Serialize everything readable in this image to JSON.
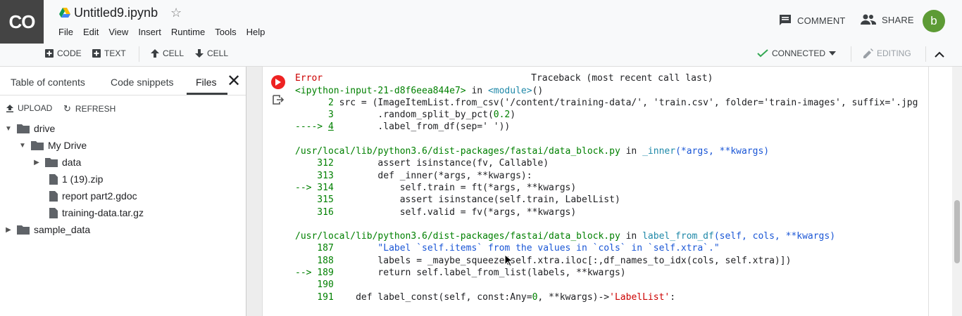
{
  "app": {
    "logo": "CO",
    "title": "Untitled9.ipynb",
    "menu": [
      "File",
      "Edit",
      "View",
      "Insert",
      "Runtime",
      "Tools",
      "Help"
    ],
    "comment_label": "COMMENT",
    "share_label": "SHARE",
    "avatar_letter": "b"
  },
  "toolbar": {
    "code_label": "CODE",
    "text_label": "TEXT",
    "cell_up_label": "CELL",
    "cell_down_label": "CELL",
    "connected_label": "CONNECTED",
    "editing_label": "EDITING"
  },
  "sidebar": {
    "tabs": [
      "Table of contents",
      "Code snippets",
      "Files"
    ],
    "upload_label": "UPLOAD",
    "refresh_label": "REFRESH",
    "tree": [
      {
        "label": "drive"
      },
      {
        "label": "My Drive"
      },
      {
        "label": "data"
      },
      {
        "label": "1 (19).zip"
      },
      {
        "label": "report part2.gdoc"
      },
      {
        "label": "training-data.tar.gz"
      },
      {
        "label": "sample_data"
      }
    ]
  },
  "output": {
    "dash_line": "---------------------------------------------------------------------------",
    "err_name": "Error",
    "traceback": "Traceback (most recent call last)",
    "frame1": {
      "input": "<ipython-input-21-d8f6eea844e7>",
      "in": " in ",
      "module": "<module>",
      "suffix": "()"
    },
    "l2_num": "      2",
    "l2_code": " src = (ImageItemList.from_csv('/content/training-data/', 'train.csv', folder='train-images', suffix='.jpg",
    "l3_num": "      3",
    "l3_code": "        .random_split_by_pct(",
    "l3_val": "0.2",
    "l3_end": ")",
    "l4_arrow": "----> ",
    "l4_num": "4",
    "l4_code": "        .label_from_df(sep=' '))",
    "frame2_path": "/usr/local/lib/python3.6/dist-packages/fastai/data_block.py",
    "frame2_in": " in ",
    "frame2_func": "_inner",
    "frame2_args": "(*args, **kwargs)",
    "f2_312": "    312",
    "f2_312c": "        assert isinstance(fv, Callable)",
    "f2_313": "    313",
    "f2_313c": "        def _inner(*args, **kwargs):",
    "f2_314": "--> 314",
    "f2_314c": "            self.train = ft(*args, **kwargs)",
    "f2_315": "    315",
    "f2_315c": "            assert isinstance(self.train, LabelList)",
    "f2_316": "    316",
    "f2_316c": "            self.valid = fv(*args, **kwargs)",
    "frame3_path": "/usr/local/lib/python3.6/dist-packages/fastai/data_block.py",
    "frame3_in": " in ",
    "frame3_func": "label_from_df",
    "frame3_args": "(self, cols, **kwargs)",
    "f3_187": "    187",
    "f3_187c": "        \"Label `self.items` from the values in `cols` in `self.xtra`.\"",
    "f3_188": "    188",
    "f3_188c": "        labels = _maybe_squeeze(self.xtra.iloc[:,df_names_to_idx(cols, self.xtra)])",
    "f3_189": "--> 189",
    "f3_189c": "        return self.label_from_list(labels, **kwargs)",
    "f3_190": "    190",
    "f3_191": "    191",
    "f3_191c": "    def label_const(self, const:Any=",
    "f3_191v": "0",
    "f3_191e": ", **kwargs)->",
    "f3_191s": "'LabelList'",
    "f3_191z": ":"
  }
}
